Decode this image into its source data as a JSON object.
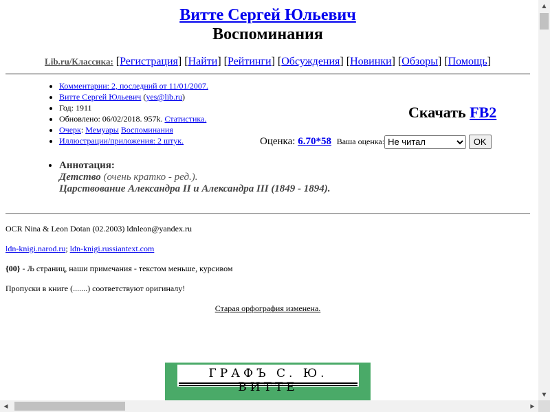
{
  "header": {
    "author": "Витте Сергей Юльевич",
    "title": "Воспоминания"
  },
  "navbar": {
    "site": "Lib.ru/Классика:",
    "links": [
      "Регистрация",
      "Найти",
      "Рейтинги",
      "Обсуждения",
      "Новинки",
      "Обзоры",
      "Помощь"
    ]
  },
  "info": {
    "comments": "Комментарии: 2, последний от 11/01/2007.",
    "author_link": "Витте Сергей Юльевич",
    "email": "yes@lib.ru",
    "year": "Год: 1911",
    "updated_prefix": "Обновлено: 06/02/2018. 957k.",
    "stats_link": "Статистика.",
    "genre_link": "Очерк",
    "genre_sep": ":",
    "genre_tag1": "Мемуары",
    "genre_tag2": "Воспоминания",
    "illustrations": "Иллюстрации/приложения: 2 штук."
  },
  "download": {
    "label": "Скачать",
    "format": "FB2"
  },
  "rating": {
    "label": "Оценка:",
    "value": "6.70*58",
    "your_label": "Ваша оценка:",
    "selected": "Не читал",
    "ok": "OK"
  },
  "annotation": {
    "label": "Аннотация:",
    "line1_main": "Детство",
    "line1_note": "(очень кратко - ред.).",
    "line2": "Царствование Александра II и Александра III (1849 - 1894)."
  },
  "body": {
    "ocr": "OCR Nina & Leon Dotan (02.2003) ldnleon@yandex.ru",
    "link1": "ldn-knigi.narod.ru",
    "link_sep": ";",
    "link2": "ldn-knigi.russiantext.com",
    "note_bold": "{00}",
    "note_text": " - Љ страниц, наши примечания - текстом меньше, курсивом",
    "gaps": "Пропуски в книге (.......) соответствуют оригиналу!",
    "orthography": "Старая орфография изменена."
  },
  "book_image": {
    "text": "ГРАФЪ С. Ю. ВИТТЕ",
    "bg_color": "#4aaa68"
  },
  "colors": {
    "link": "#0000ee",
    "hr": "#888888",
    "scrollbar": "#c1c1c1"
  }
}
